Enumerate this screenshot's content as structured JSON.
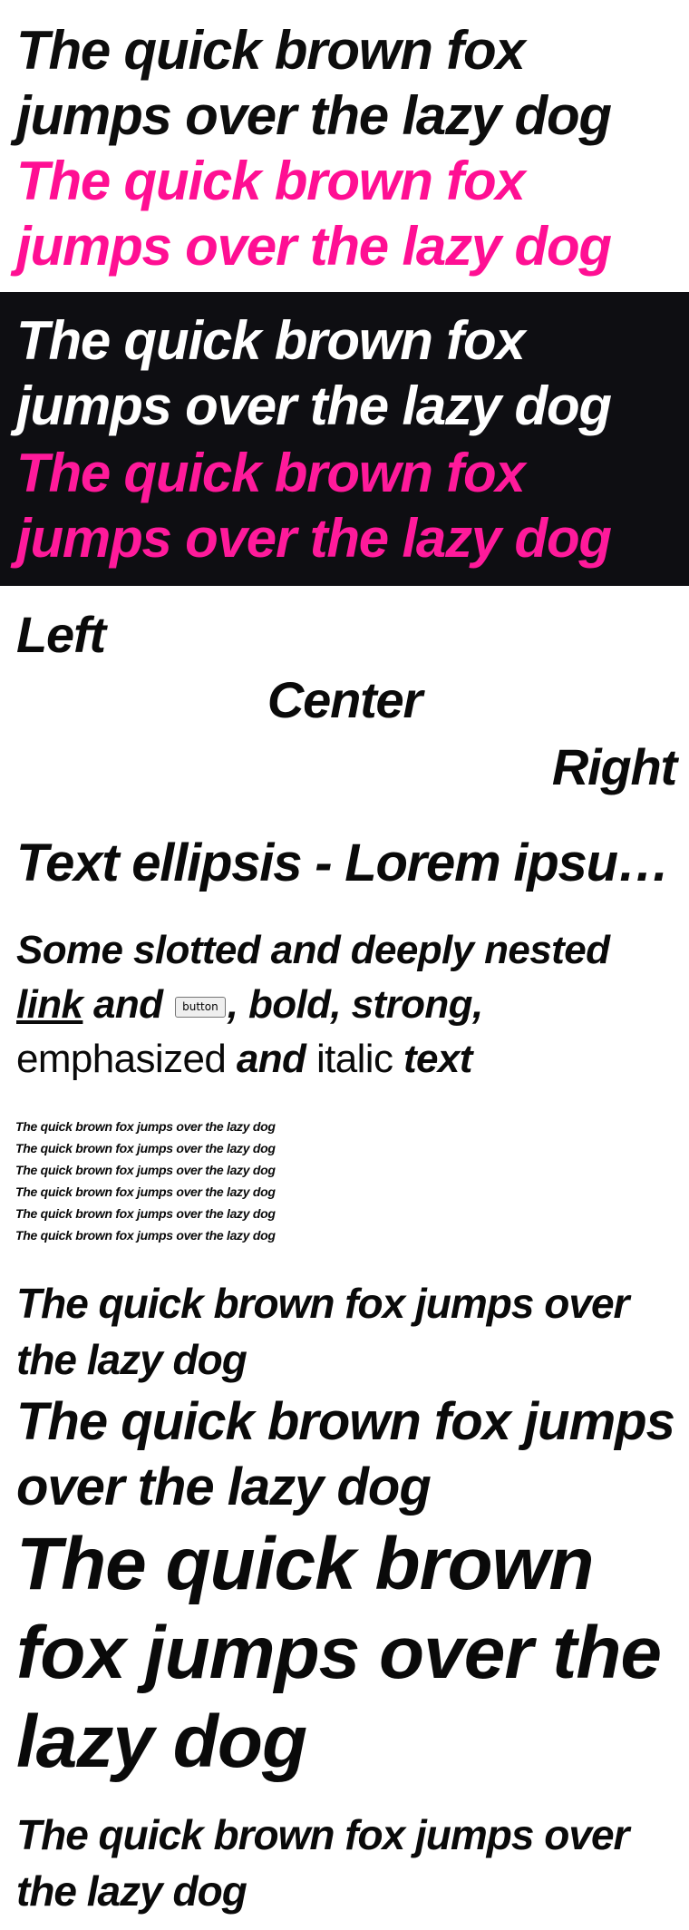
{
  "themes": {
    "light": {
      "default_text": "The quick brown fox jumps over the lazy dog",
      "accent_text": "The quick brown fox jumps over the lazy dog",
      "background": "#ffffff",
      "text_color": "#0d0d0d",
      "accent_color": "#ff0f93"
    },
    "dark": {
      "default_text": "The quick brown fox jumps over the lazy dog",
      "accent_text": "The quick brown fox jumps over the lazy dog",
      "background": "#0e0e12",
      "text_color": "#ffffff",
      "accent_color": "#ff1a9b"
    }
  },
  "alignment": {
    "left": "Left",
    "center": "Center",
    "right": "Right"
  },
  "ellipsis": {
    "text": "Text ellipsis - Lorem ipsum dolor sit amet, consetetur sadipscing elitr"
  },
  "slotted": {
    "intro": "Some slotted and deeply nested",
    "link": "link",
    "and1": "and",
    "button": "button",
    "comma_after_button": ",",
    "bold": "bold",
    "comma1": ",",
    "strong": "strong",
    "comma2": ",",
    "emphasized": "emphasized",
    "and2": "and",
    "italic": "italic",
    "text": "text"
  },
  "small_lines": [
    "The quick brown fox jumps over the lazy dog",
    "The quick brown fox jumps over the lazy dog",
    "The quick brown fox jumps over the lazy dog",
    "The quick brown fox jumps over the lazy dog",
    "The quick brown fox jumps over the lazy dog",
    "The quick brown fox jumps over the lazy dog"
  ],
  "sizes": [
    "The quick brown fox jumps over the lazy dog",
    "The quick brown fox jumps over the lazy dog",
    "The quick brown fox jumps over the lazy dog",
    "The quick brown fox jumps over the lazy dog"
  ]
}
